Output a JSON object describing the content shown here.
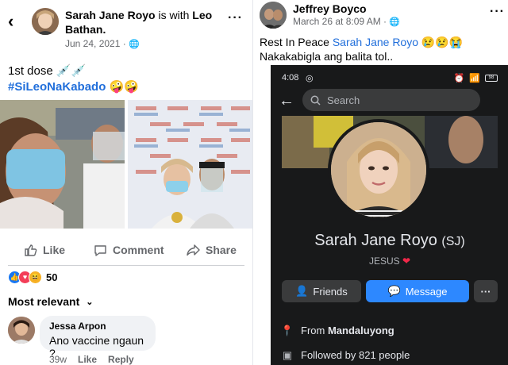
{
  "left_post": {
    "author": "Sarah Jane Royo",
    "with_text": "is with",
    "tagged": "Leo Bathan.",
    "date": "Jun 24, 2021 · ",
    "text_line1": "1st dose 💉💉",
    "hashtag": "#SiLeoNaKabado",
    "hashtag_emoji": " 🤪🤪",
    "actions": {
      "like": "Like",
      "comment": "Comment",
      "share": "Share"
    },
    "reaction_count": "50",
    "comments_filter": "Most relevant",
    "comment": {
      "name": "Jessa Arpon",
      "text": "Ano vaccine ngaun ?",
      "time": "39w",
      "like": "Like",
      "reply": "Reply"
    },
    "colors": {
      "link": "#216fdb",
      "meta": "#65676b",
      "like_blue": "#1877f2"
    }
  },
  "right_post": {
    "author": "Jeffrey Boyco",
    "date": "March 26 at 8:09 AM · ",
    "text_prefix": "Rest In Peace ",
    "mention": "Sarah Jane Royo",
    "text_emoji": " 😢😢😭",
    "text_line2": "Nakakabigla ang balita tol..",
    "phone": {
      "time": "4:08",
      "battery": "98",
      "search_placeholder": "Search",
      "profile_name": "Sarah Jane Royo",
      "profile_nick": "(SJ)",
      "bio": "JESUS",
      "friends_button": "Friends",
      "message_button": "Message",
      "more_button": "···",
      "from_label": "From",
      "from_value": "Mandaluyong",
      "followers": "Followed by 821 people"
    },
    "colors": {
      "dark_bg": "#18191a",
      "button_blue": "#2d88ff",
      "heart": "#f02849"
    }
  }
}
